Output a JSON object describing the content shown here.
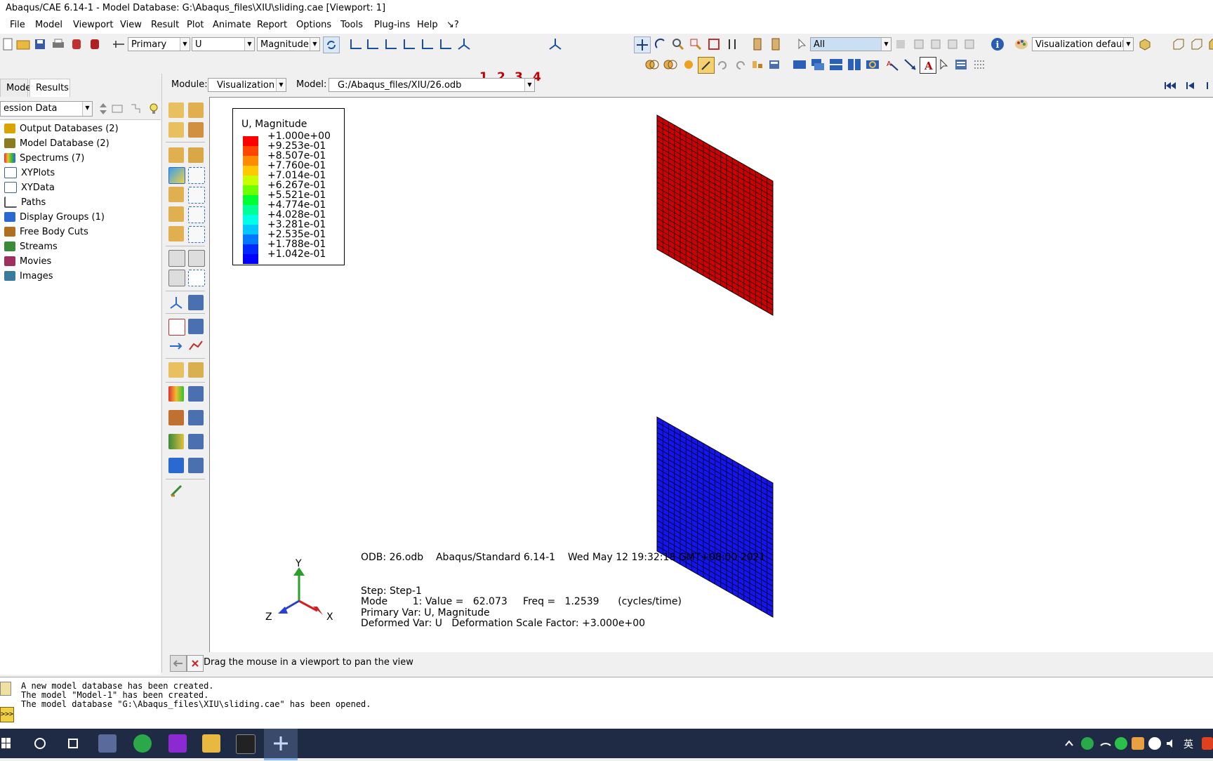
{
  "window": {
    "title": "Abaqus/CAE 6.14-1 - Model Database: G:\\Abaqus_files\\XIU\\sliding.cae [Viewport: 1]"
  },
  "menu": [
    "File",
    "Model",
    "Viewport",
    "View",
    "Result",
    "Plot",
    "Animate",
    "Report",
    "Options",
    "Tools",
    "Plug-ins",
    "Help",
    "↘?"
  ],
  "toolbar": {
    "step_combo": "Primary",
    "var_combo": "U",
    "comp_combo": "Magnitude",
    "numbers": [
      "1",
      "2",
      "3",
      "4"
    ],
    "selection_filter": "All",
    "vis_defaults": "Visualization defaults"
  },
  "context": {
    "module_label": "Module:",
    "module_value": "Visualization",
    "model_label": "Model:",
    "model_value": "G:/Abaqus_files/XIU/26.odb"
  },
  "tabs": [
    "Model",
    "Results"
  ],
  "session_combo": "ession Data",
  "tree": [
    {
      "label": "Output Databases (2)",
      "color": "#d9a400"
    },
    {
      "label": "Model Database (2)",
      "color": "#8a7a20"
    },
    {
      "label": "Spectrums (7)",
      "color": "#e03030"
    },
    {
      "label": "XYPlots",
      "color": "#4060a0"
    },
    {
      "label": "XYData",
      "color": "#4060a0"
    },
    {
      "label": "Paths",
      "color": "#555555"
    },
    {
      "label": "Display Groups (1)",
      "color": "#2a6ad0"
    },
    {
      "label": "Free Body Cuts",
      "color": "#b07020"
    },
    {
      "label": "Streams",
      "color": "#3a8a3a"
    },
    {
      "label": "Movies",
      "color": "#a03060"
    },
    {
      "label": "Images",
      "color": "#3a7a9a"
    }
  ],
  "legend": {
    "title": "U, Magnitude",
    "values": [
      "+1.000e+00",
      "+9.253e-01",
      "+8.507e-01",
      "+7.760e-01",
      "+7.014e-01",
      "+6.267e-01",
      "+5.521e-01",
      "+4.774e-01",
      "+4.028e-01",
      "+3.281e-01",
      "+2.535e-01",
      "+1.788e-01",
      "+1.042e-01"
    ],
    "colors": [
      "#ff0000",
      "#ff4600",
      "#ff8c00",
      "#ffc800",
      "#c8ff00",
      "#6eff00",
      "#00ff32",
      "#00ff96",
      "#00ffe6",
      "#00c8ff",
      "#0078ff",
      "#0028ff",
      "#0000ff"
    ]
  },
  "info": {
    "odb_line": "ODB: 26.odb    Abaqus/Standard 6.14-1    Wed May 12 19:32:18 GMT+08:00 2021",
    "step_line": "Step: Step-1",
    "mode_line": "Mode        1: Value =   62.073     Freq =   1.2539      (cycles/time)",
    "primary_line": "Primary Var: U, Magnitude",
    "deformed_line": "Deformed Var: U   Deformation Scale Factor: +3.000e+00"
  },
  "triad": {
    "y": "Y",
    "z": "Z",
    "x": "X"
  },
  "status": "Drag the mouse in a viewport to pan the view",
  "messages": [
    "A new model database has been created.",
    "The model \"Model-1\" has been created.",
    "The model database \"G:\\Abaqus_files\\XIU\\sliding.cae\" has been opened."
  ],
  "taskbar": {
    "ime": "英"
  },
  "colors": {
    "mesh_red": "#cc0000",
    "mesh_blue": "#1414ee"
  }
}
